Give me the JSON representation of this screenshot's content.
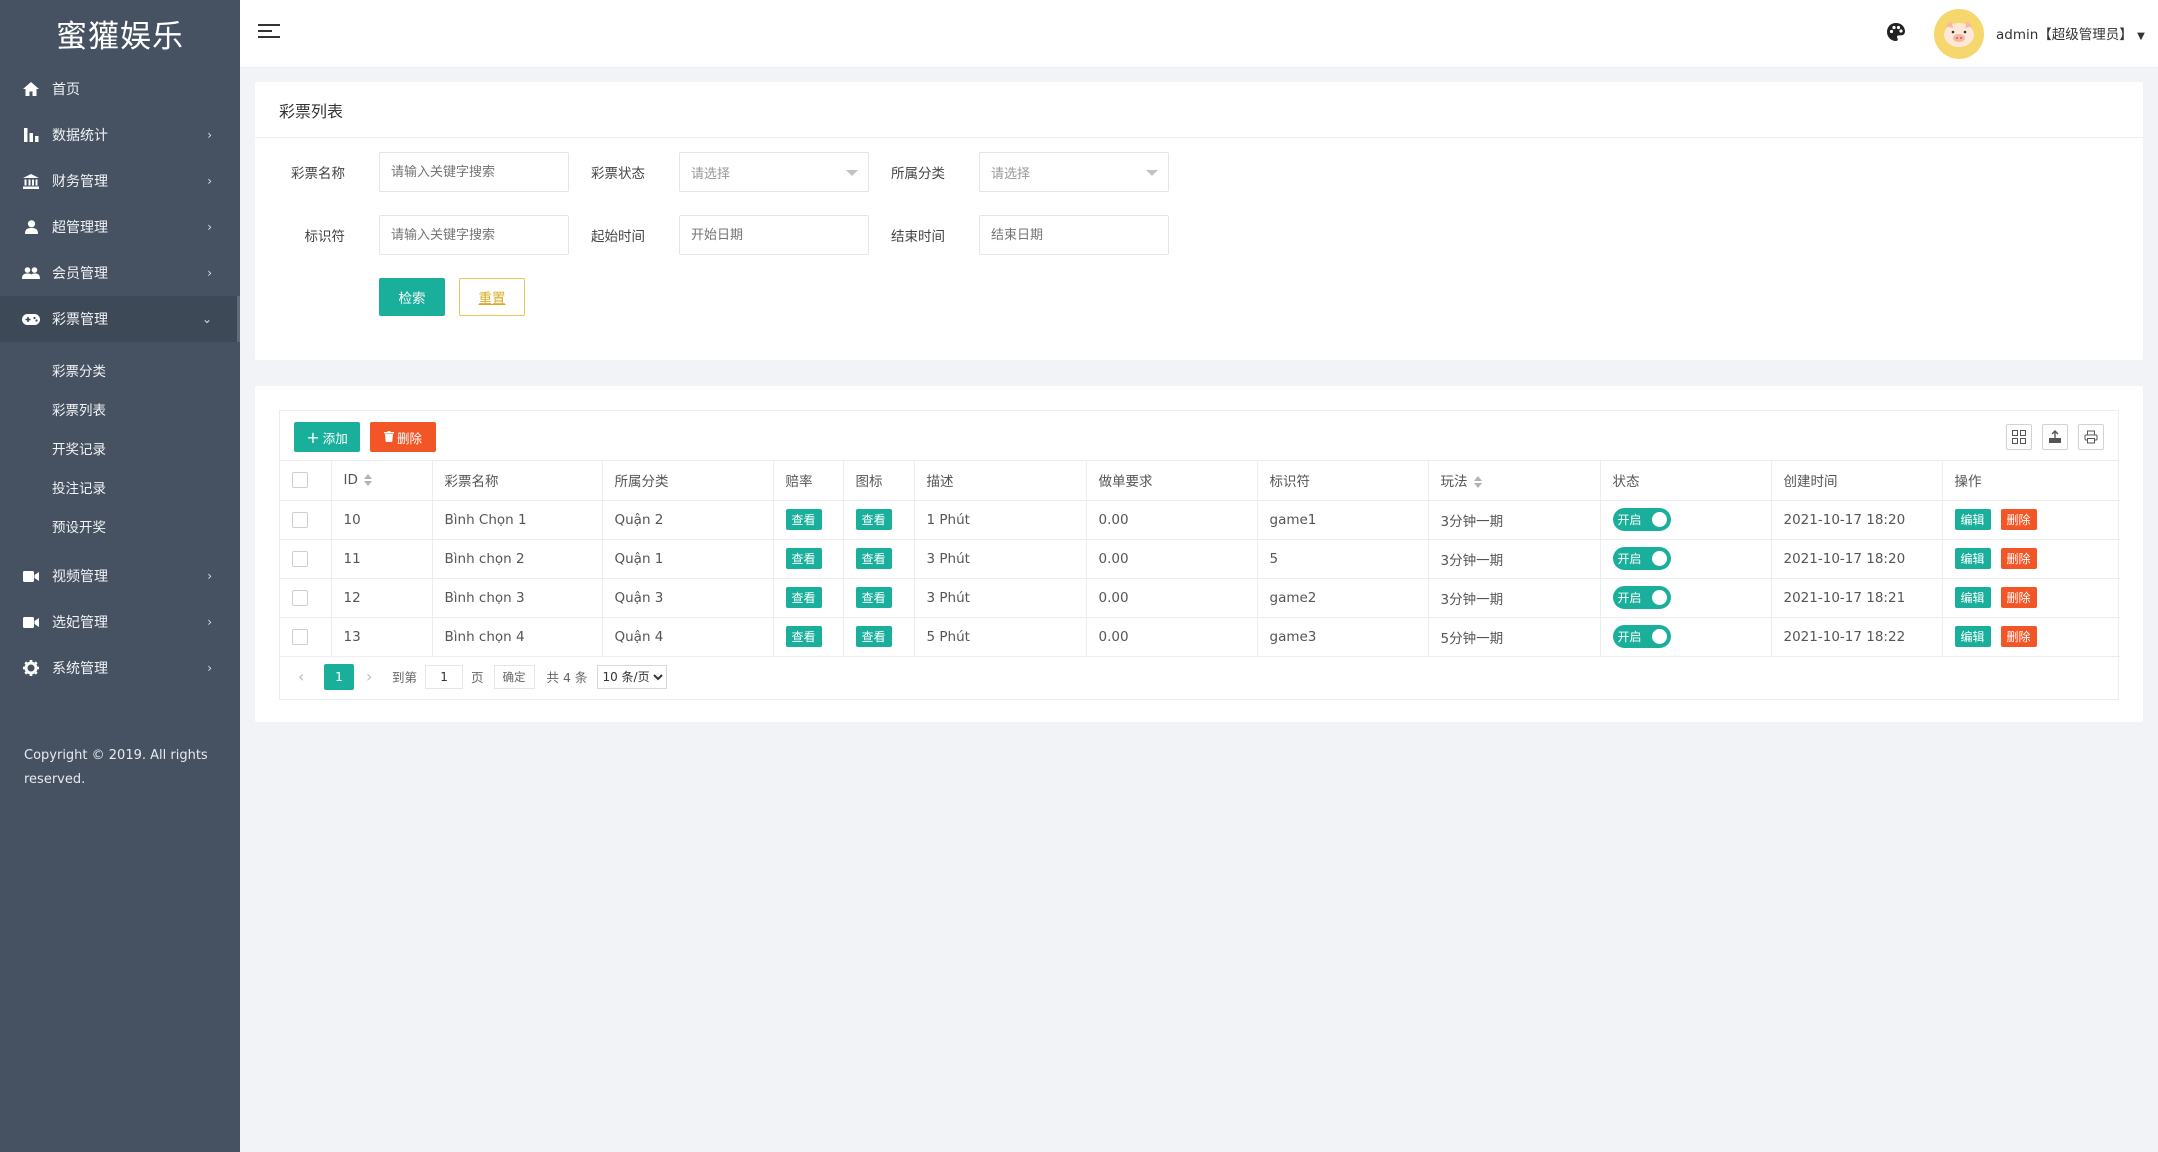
{
  "sidebar": {
    "logo": "蜜獾娱乐",
    "items": [
      {
        "label": "首页",
        "icon": "home-icon"
      },
      {
        "label": "数据统计",
        "icon": "bar-chart-icon"
      },
      {
        "label": "财务管理",
        "icon": "bank-icon"
      },
      {
        "label": "超管理理",
        "icon": "user-icon"
      },
      {
        "label": "会员管理",
        "icon": "users-icon"
      },
      {
        "label": "彩票管理",
        "icon": "gamepad-icon"
      }
    ],
    "submenu": [
      "彩票分类",
      "彩票列表",
      "开奖记录",
      "投注记录",
      "预设开奖"
    ],
    "items_after": [
      {
        "label": "视频管理",
        "icon": "video-icon"
      },
      {
        "label": "选妃管理",
        "icon": "video-icon"
      },
      {
        "label": "系统管理",
        "icon": "gear-icon"
      }
    ],
    "copyright": "Copyright © 2019. All rights reserved."
  },
  "header": {
    "user": "admin【超级管理员】"
  },
  "search": {
    "title": "彩票列表",
    "name_label": "彩票名称",
    "name_placeholder": "请输入关键字搜索",
    "status_label": "彩票状态",
    "status_value": "请选择",
    "category_label": "所属分类",
    "category_value": "请选择",
    "key_label": "标识符",
    "key_placeholder": "请输入关键字搜索",
    "start_label": "起始时间",
    "start_placeholder": "开始日期",
    "end_label": "结束时间",
    "end_placeholder": "结束日期",
    "search_btn": "检索",
    "reset_btn": "重置"
  },
  "toolbar": {
    "add": "添加",
    "delete": "删除"
  },
  "table": {
    "headers": [
      "ID",
      "彩票名称",
      "所属分类",
      "赔率",
      "图标",
      "描述",
      "做单要求",
      "标识符",
      "玩法",
      "状态",
      "创建时间",
      "操作"
    ],
    "rows": [
      {
        "id": "10",
        "name": "Bình Chọn 1",
        "category": "Quận 2",
        "odds": "查看",
        "icon": "查看",
        "desc": "1 Phút",
        "req": "0.00",
        "key": "game1",
        "play": "3分钟一期",
        "status": "开启",
        "created": "2021-10-17 18:20",
        "edit": "编辑",
        "del": "删除"
      },
      {
        "id": "11",
        "name": "Bình chọn 2",
        "category": "Quận 1",
        "odds": "查看",
        "icon": "查看",
        "desc": "3 Phút",
        "req": "0.00",
        "key": "5",
        "play": "3分钟一期",
        "status": "开启",
        "created": "2021-10-17 18:20",
        "edit": "编辑",
        "del": "删除"
      },
      {
        "id": "12",
        "name": "Bình chọn 3",
        "category": "Quận 3",
        "odds": "查看",
        "icon": "查看",
        "desc": "3 Phút",
        "req": "0.00",
        "key": "game2",
        "play": "3分钟一期",
        "status": "开启",
        "created": "2021-10-17 18:21",
        "edit": "编辑",
        "del": "删除"
      },
      {
        "id": "13",
        "name": "Bình chọn 4",
        "category": "Quận 4",
        "odds": "查看",
        "icon": "查看",
        "desc": "5 Phút",
        "req": "0.00",
        "key": "game3",
        "play": "5分钟一期",
        "status": "开启",
        "created": "2021-10-17 18:22",
        "edit": "编辑",
        "del": "删除"
      }
    ]
  },
  "pager": {
    "current": "1",
    "goto_label": "到第",
    "goto_value": "1",
    "page_suffix": "页",
    "confirm": "确定",
    "total": "共 4 条",
    "page_size": "10 条/页"
  },
  "colors": {
    "sidebar": "#465262",
    "primary": "#1aaf9b",
    "danger": "#f35626",
    "warn": "#d8ab27"
  }
}
